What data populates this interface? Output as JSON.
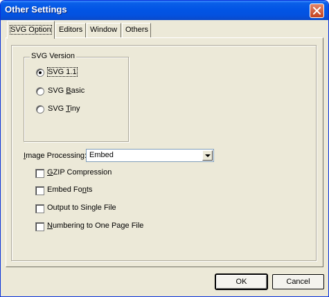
{
  "window": {
    "title": "Other Settings"
  },
  "tabs": [
    {
      "label": "SVG Option",
      "active": true
    },
    {
      "label": "Editors",
      "active": false
    },
    {
      "label": "Window",
      "active": false
    },
    {
      "label": "Others",
      "active": false
    }
  ],
  "svg_version": {
    "legend": "SVG Version",
    "options": [
      {
        "label": "SVG 1.1",
        "checked": true
      },
      {
        "label_pre": "SVG ",
        "label_u": "B",
        "label_post": "asic",
        "checked": false
      },
      {
        "label_pre": "SVG ",
        "label_u": "T",
        "label_post": "iny",
        "checked": false
      }
    ]
  },
  "image_processing": {
    "label_u": "I",
    "label_post": "mage Processing:",
    "value": "Embed"
  },
  "checkboxes": [
    {
      "label_pre": "",
      "label_u": "G",
      "label_post": "ZIP Compression",
      "checked": false
    },
    {
      "label_pre": "Embed Fo",
      "label_u": "n",
      "label_post": "ts",
      "checked": false
    },
    {
      "label_pre": "Output to Single File",
      "label_u": "",
      "label_post": "",
      "checked": false
    },
    {
      "label_pre": "",
      "label_u": "N",
      "label_post": "umbering to One Page File",
      "checked": false
    }
  ],
  "buttons": {
    "ok": "OK",
    "cancel": "Cancel"
  },
  "icons": {
    "close": "close-icon",
    "dropdown": "chevron-down-icon"
  }
}
